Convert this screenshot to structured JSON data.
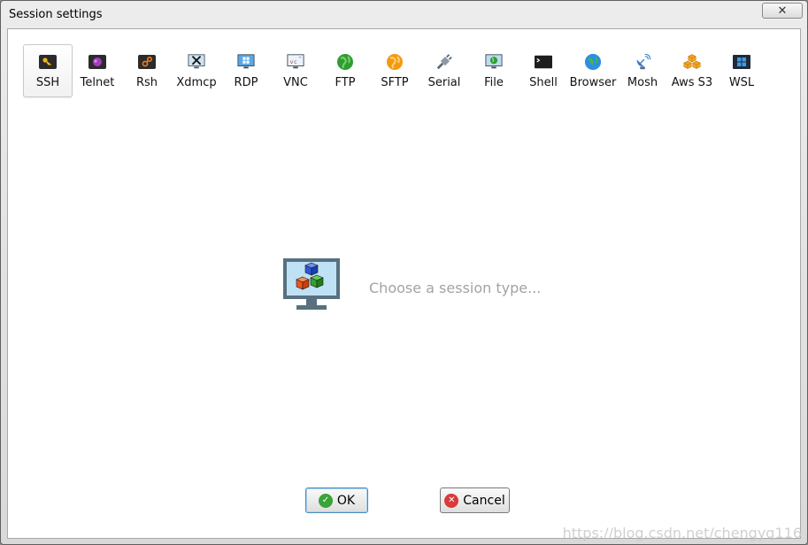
{
  "window": {
    "title": "Session settings",
    "close_label": "✕"
  },
  "session_types": [
    {
      "id": "ssh",
      "label": "SSH",
      "icon": "key-icon",
      "selected": true
    },
    {
      "id": "telnet",
      "label": "Telnet",
      "icon": "telnet-icon"
    },
    {
      "id": "rsh",
      "label": "Rsh",
      "icon": "rsh-icon"
    },
    {
      "id": "xdmcp",
      "label": "Xdmcp",
      "icon": "x-monitor-icon"
    },
    {
      "id": "rdp",
      "label": "RDP",
      "icon": "windows-monitor-icon"
    },
    {
      "id": "vnc",
      "label": "VNC",
      "icon": "vnc-monitor-icon"
    },
    {
      "id": "ftp",
      "label": "FTP",
      "icon": "green-globe-icon"
    },
    {
      "id": "sftp",
      "label": "SFTP",
      "icon": "orange-globe-icon"
    },
    {
      "id": "serial",
      "label": "Serial",
      "icon": "serial-plug-icon"
    },
    {
      "id": "file",
      "label": "File",
      "icon": "file-monitor-icon"
    },
    {
      "id": "shell",
      "label": "Shell",
      "icon": "terminal-icon"
    },
    {
      "id": "browser",
      "label": "Browser",
      "icon": "browser-globe-icon"
    },
    {
      "id": "mosh",
      "label": "Mosh",
      "icon": "satellite-dish-icon"
    },
    {
      "id": "awss3",
      "label": "Aws S3",
      "icon": "cubes-icon"
    },
    {
      "id": "wsl",
      "label": "WSL",
      "icon": "windows-logo-icon"
    }
  ],
  "placeholder": {
    "text": "Choose a session type...",
    "icon": "monitor-cubes-icon"
  },
  "buttons": {
    "ok_label": "OK",
    "cancel_label": "Cancel"
  },
  "watermark": "https://blog.csdn.net/chengyq116",
  "colors": {
    "ok_icon": "#3aa33a",
    "cancel_icon": "#d93a3a"
  }
}
